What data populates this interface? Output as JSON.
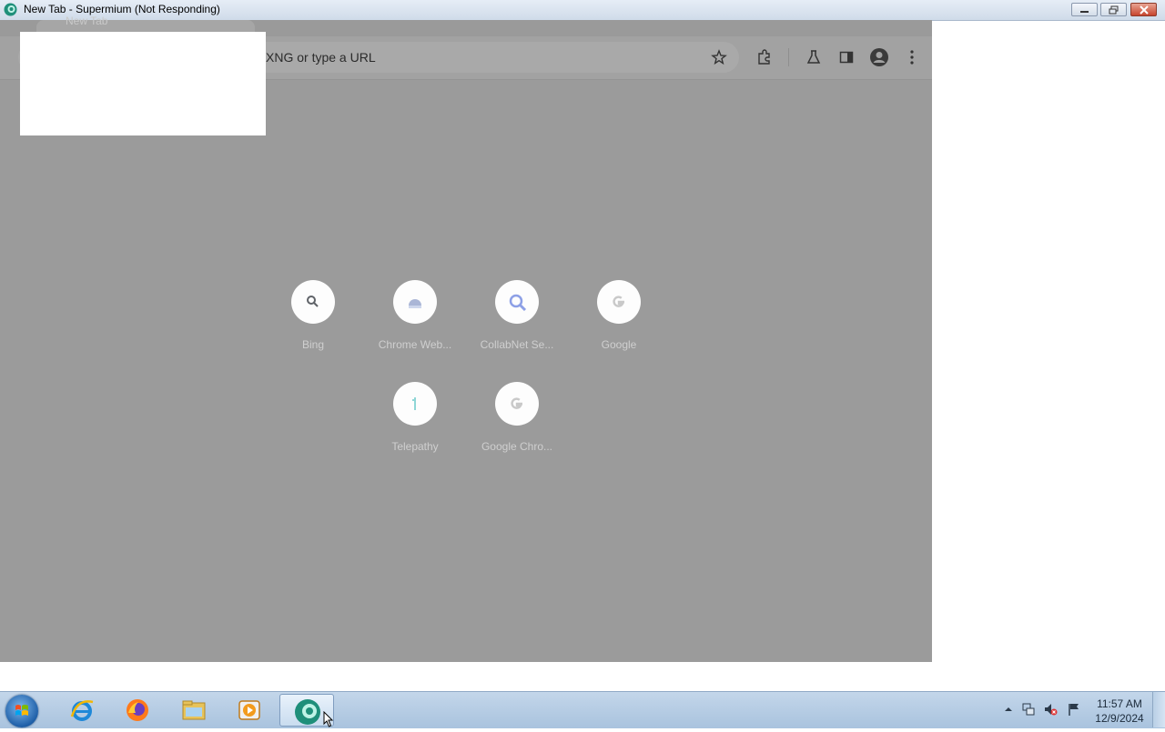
{
  "window": {
    "title": "New Tab - Supermium (Not Responding)"
  },
  "browser": {
    "tab_title": "New Tab",
    "omnibox_placeholder": "XNG or type a URL",
    "toolbar_icons": [
      "star-icon",
      "extensions-icon",
      "labs-icon",
      "sidepanel-icon",
      "profile-icon",
      "menu-icon"
    ],
    "shortcuts": [
      {
        "label": "Bing",
        "icon": "search-icon"
      },
      {
        "label": "Chrome Web...",
        "icon": "chrome-web-store-icon"
      },
      {
        "label": "CollabNet Se...",
        "icon": "magnifier-icon"
      },
      {
        "label": "Google",
        "icon": "google-icon"
      },
      {
        "label": "Telepathy",
        "icon": "telepathy-icon"
      },
      {
        "label": "Google Chro...",
        "icon": "google-icon"
      }
    ]
  },
  "taskbar": {
    "apps": [
      "start-orb-icon",
      "internet-explorer-icon",
      "firefox-icon",
      "file-explorer-icon",
      "media-player-icon",
      "supermium-icon"
    ],
    "tray_icons": [
      "show-hidden-icon",
      "network-icon",
      "volume-muted-icon",
      "action-center-flag-icon"
    ],
    "time": "11:57 AM",
    "date": "12/9/2024"
  },
  "colors": {
    "dim_overlay": "#9b9b9b",
    "taskbar": "#b6cce4",
    "close_button": "#c7452e"
  }
}
